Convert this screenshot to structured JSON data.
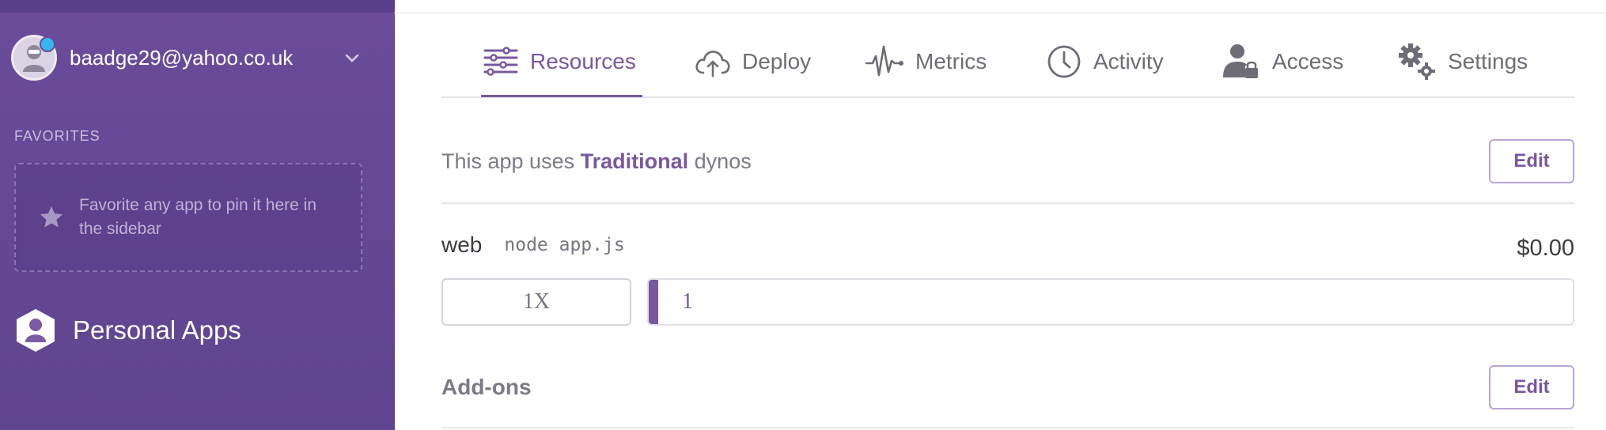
{
  "sidebar": {
    "account_email": "baadge29@yahoo.co.uk",
    "favorites_heading": "FAVORITES",
    "favorites_empty_text": "Favorite any app to pin it here in the sidebar",
    "personal_apps_label": "Personal Apps"
  },
  "tabs": [
    {
      "label": "Resources",
      "icon": "resources-icon",
      "active": true
    },
    {
      "label": "Deploy",
      "icon": "deploy-cloud-icon",
      "active": false
    },
    {
      "label": "Metrics",
      "icon": "metrics-pulse-icon",
      "active": false
    },
    {
      "label": "Activity",
      "icon": "activity-clock-icon",
      "active": false
    },
    {
      "label": "Access",
      "icon": "access-user-lock-icon",
      "active": false
    },
    {
      "label": "Settings",
      "icon": "settings-gears-icon",
      "active": false
    }
  ],
  "dyno": {
    "prefix": "This app uses",
    "type": "Traditional",
    "suffix": "dynos",
    "edit_label": "Edit"
  },
  "process": {
    "name": "web",
    "command": "node app.js",
    "price": "$0.00",
    "size": "1X",
    "count": "1"
  },
  "addons": {
    "title": "Add-ons",
    "edit_label": "Edit"
  },
  "colors": {
    "brand_purple": "#79589f",
    "sidebar_bg": "#664a96",
    "notification_dot": "#35b6f0"
  }
}
